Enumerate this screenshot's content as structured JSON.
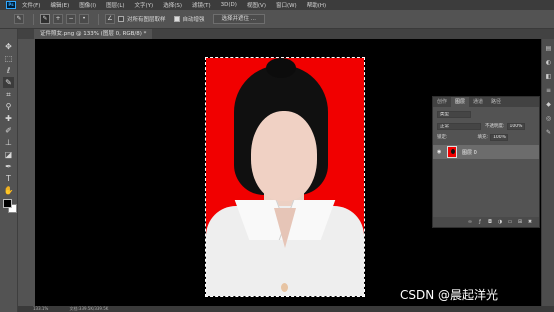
{
  "menubar": {
    "logo": "Ps",
    "items": [
      "文件(F)",
      "编辑(E)",
      "图像(I)",
      "图层(L)",
      "文字(Y)",
      "选择(S)",
      "滤镜(T)",
      "3D(D)",
      "视图(V)",
      "窗口(W)",
      "帮助(H)"
    ]
  },
  "options": {
    "sample_all_layers_label": "对所有图层取样",
    "auto_enhance_label": "自动增强",
    "select_and_mask_label": "选择并遮住 ..."
  },
  "document": {
    "tab_title": "证件照女.png @ 133% (图层 0, RGB/8) *",
    "zoom": "133.1%",
    "doc_size": "文档:339.5K/339.5K"
  },
  "layers_panel": {
    "tabs": [
      "创作",
      "图层",
      "通道",
      "路径"
    ],
    "active_tab": "图层",
    "filter_label": "类型",
    "blend_mode": "正常",
    "opacity_label": "不透明度:",
    "opacity_value": "100%",
    "lock_label": "锁定:",
    "fill_label": "填充:",
    "fill_value": "100%",
    "layer_name": "图层 0"
  },
  "watermark": "CSDN @晨起洋光",
  "colors": {
    "photo_background": "#f10000",
    "canvas": "#000000",
    "ui_dark": "#3c3c3c",
    "ui_mid": "#535353",
    "accent": "#31a8ff"
  },
  "icons": {
    "toolbar": [
      "move-icon",
      "marquee-icon",
      "lasso-icon",
      "quick-select-icon",
      "crop-icon",
      "eyedropper-icon",
      "healing-icon",
      "brush-icon",
      "stamp-icon",
      "history-brush-icon",
      "eraser-icon",
      "gradient-icon",
      "blur-icon",
      "dodge-icon",
      "pen-icon",
      "type-icon",
      "path-select-icon",
      "shape-icon",
      "hand-icon",
      "zoom-icon"
    ]
  }
}
